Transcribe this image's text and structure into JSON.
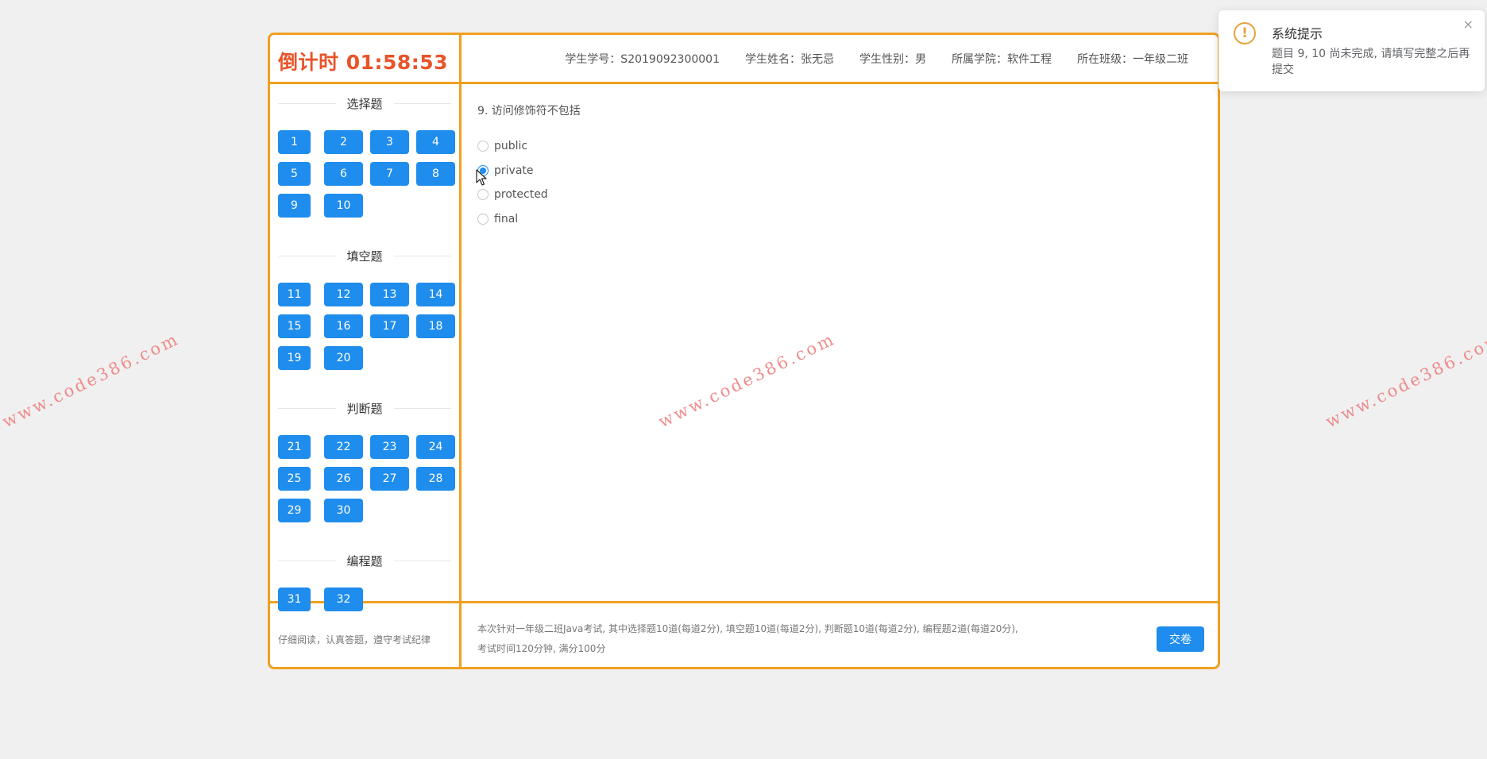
{
  "timer": "倒计时 01:58:53",
  "student": {
    "id": "学生学号：S2019092300001",
    "name": "学生姓名：张无忌",
    "gender": "学生性别：男",
    "college": "所属学院：软件工程",
    "class": "所在班级：一年级二班"
  },
  "sections": [
    {
      "title": "选择题",
      "questions": [
        "1",
        "2",
        "3",
        "4",
        "5",
        "6",
        "7",
        "8",
        "9",
        "10"
      ]
    },
    {
      "title": "填空题",
      "questions": [
        "11",
        "12",
        "13",
        "14",
        "15",
        "16",
        "17",
        "18",
        "19",
        "20"
      ]
    },
    {
      "title": "判断题",
      "questions": [
        "21",
        "22",
        "23",
        "24",
        "25",
        "26",
        "27",
        "28",
        "29",
        "30"
      ]
    },
    {
      "title": "编程题",
      "questions": [
        "31",
        "32"
      ]
    }
  ],
  "question": {
    "text": "9. 访问修饰符不包括",
    "options": [
      "public",
      "private",
      "protected",
      "final"
    ],
    "selected": "private"
  },
  "footer": {
    "left": "仔细阅读，认真答题，遵守考试纪律",
    "note": "本次针对一年级二班Java考试, 其中选择题10道(每道2分), 填空题10道(每道2分), 判断题10道(每道2分), 编程题2道(每道20分), 考试时间120分钟, 满分100分",
    "submit_label": "交卷"
  },
  "notification": {
    "title": "系统提示",
    "message": "题目 9, 10 尚未完成, 请填写完整之后再提交",
    "icon": "warning-icon",
    "close_glyph": "×"
  },
  "watermark": "www.code386.com",
  "colors": {
    "border": "#f0a020",
    "button": "#1f8ded",
    "timer": "#e8542a",
    "warning": "#e6a23c"
  }
}
